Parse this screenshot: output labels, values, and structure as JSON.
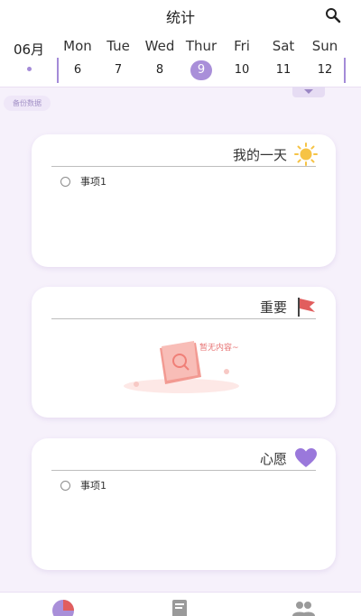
{
  "header": {
    "title": "统计"
  },
  "calendar": {
    "month": "06月",
    "days": [
      {
        "weekday": "Mon",
        "date": "6",
        "selected": false
      },
      {
        "weekday": "Tue",
        "date": "7",
        "selected": false
      },
      {
        "weekday": "Wed",
        "date": "8",
        "selected": false
      },
      {
        "weekday": "Thur",
        "date": "9",
        "selected": true
      },
      {
        "weekday": "Fri",
        "date": "10",
        "selected": false
      },
      {
        "weekday": "Sat",
        "date": "11",
        "selected": false
      },
      {
        "weekday": "Sun",
        "date": "12",
        "selected": false
      }
    ]
  },
  "backup_label": "备份数据",
  "cards": [
    {
      "title": "我的一天",
      "icon": "sun-icon",
      "items": [
        "事项1"
      ]
    },
    {
      "title": "重要",
      "icon": "flag-icon",
      "empty_text": "暂无内容~"
    },
    {
      "title": "心愿",
      "icon": "heart-icon",
      "items": [
        "事项1"
      ]
    }
  ],
  "tabbar": {
    "icons": [
      "stats-icon",
      "notes-icon",
      "people-icon"
    ]
  },
  "colors": {
    "accent": "#a98fd9",
    "background": "#f6f1fb",
    "flag": "#e15e5e",
    "heart": "#9a78db",
    "sun": "#f6c345"
  }
}
